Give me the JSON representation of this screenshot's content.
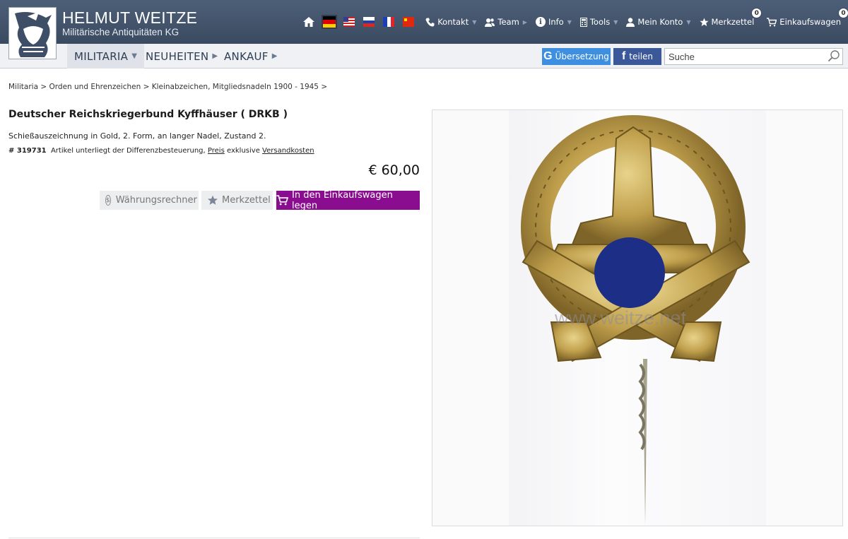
{
  "brand": {
    "name": "HELMUT WEITZE",
    "subtitle": "Militärische Antiquitäten KG"
  },
  "topnav": {
    "links": [
      {
        "label": "Kontakt",
        "icon": "phone-icon"
      },
      {
        "label": "Team",
        "icon": "team-icon"
      },
      {
        "label": "Info",
        "icon": "info-icon",
        "glyph": "i"
      },
      {
        "label": "Tools",
        "icon": "calculator-icon"
      },
      {
        "label": "Mein Konto",
        "icon": "user-icon"
      },
      {
        "label": "Merkzettel",
        "icon": "star-icon",
        "badge": "0"
      },
      {
        "label": "Einkaufswagen",
        "icon": "cart-icon",
        "badge": "0"
      }
    ],
    "languages": [
      "de",
      "us",
      "ru",
      "fr",
      "cn"
    ]
  },
  "categories": [
    {
      "label": "MILITARIA"
    },
    {
      "label": "NEUHEITEN"
    },
    {
      "label": "ANKAUF"
    }
  ],
  "actions": {
    "translate_glyph": "G",
    "translate_label": "Übersetzung",
    "share_glyph": "f",
    "share_label": "teilen",
    "search_value": "Suche"
  },
  "breadcrumb": "Militaria > Orden und Ehrenzeichen > Kleinabzeichen, Mitgliedsnadeln 1900 - 1945 >",
  "product": {
    "title": "Deutscher Reichskriegerbund Kyffhäuser ( DRKB )",
    "description": "Schießauszeichnung in Gold, 2. Form, an langer Nadel, Zustand 2.",
    "article_no": "# 319731",
    "tax_note": "Artikel unterliegt der Differenzbesteuerung,",
    "price_link": "Preis",
    "exclusive": "exklusive",
    "shipping_link": "Versandkosten",
    "price": "€ 60,00",
    "currency_btn": "Währungsrechner",
    "currency_glyph": "$",
    "wishlist_btn": "Merkzettel",
    "cart_btn": "In den Einkaufswagen legen"
  },
  "image": {
    "watermark": "www.weitze.net"
  },
  "colors": {
    "header": "#3a4a60",
    "cart_button": "#8a0c8f",
    "google_button": "#3e8fe0",
    "facebook_button": "#3b5998"
  }
}
